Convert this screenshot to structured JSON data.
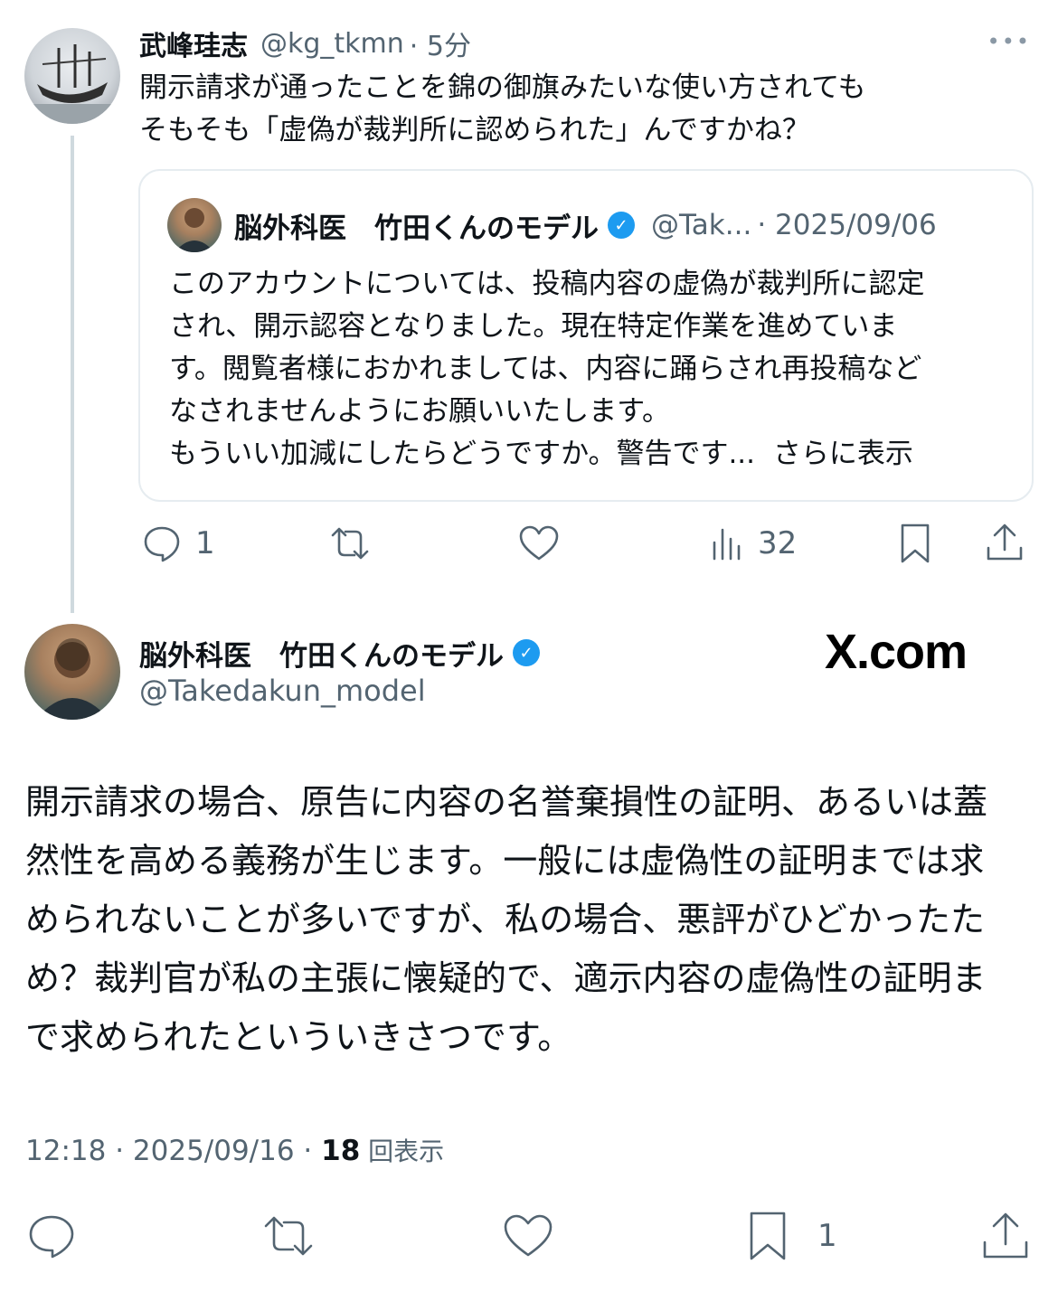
{
  "reply": {
    "display_name": "武峰珪志",
    "handle": "@kg_tkmn",
    "time": "· 5分",
    "more": "•••",
    "text_line1": "開示請求が通ったことを錦の御旗みたいな使い方されても",
    "text_line2": "そもそも「虚偽が裁判所に認められた」んですかね？",
    "quote": {
      "display_name": "脳外科医　竹田くんのモデル",
      "handle": "@Tak...",
      "date": "· 2025/09/06",
      "lines": [
        "このアカウントについては、投稿内容の虚偽が裁判所に認定",
        "され、開示認容となりました。現在特定作業を進めていま",
        "す。閲覧者様におかれましては、内容に踊らされ再投稿など",
        "なされませんようにお願いいたします。"
      ],
      "last_line": "もういい加減にしたらどうですか。警告です...",
      "show_more": "さらに表示"
    },
    "actions": {
      "reply_count": "1",
      "views_count": "32"
    }
  },
  "main": {
    "display_name": "脳外科医　竹田くんのモデル",
    "handle": "@Takedakun_model",
    "watermark": "X.com",
    "body_lines": [
      "開示請求の場合、原告に内容の名誉棄損性の証明、あるいは蓋",
      "然性を高める義務が生じます。一般には虚偽性の証明までは求",
      "められないことが多いですが、私の場合、悪評がひどかったた",
      "め？裁判官が私の主張に懐疑的で、適示内容の虚偽性の証明ま",
      "で求められたといういきさつです。"
    ],
    "meta_time": "12:18 · 2025/09/16 · ",
    "meta_views": "18",
    "meta_views_label": " 回表示",
    "actions": {
      "bookmark_count": "1"
    }
  },
  "colors": {
    "accent": "#1d9bf0",
    "text": "#0f1419",
    "muted": "#536471",
    "border": "#e6ecf0"
  }
}
